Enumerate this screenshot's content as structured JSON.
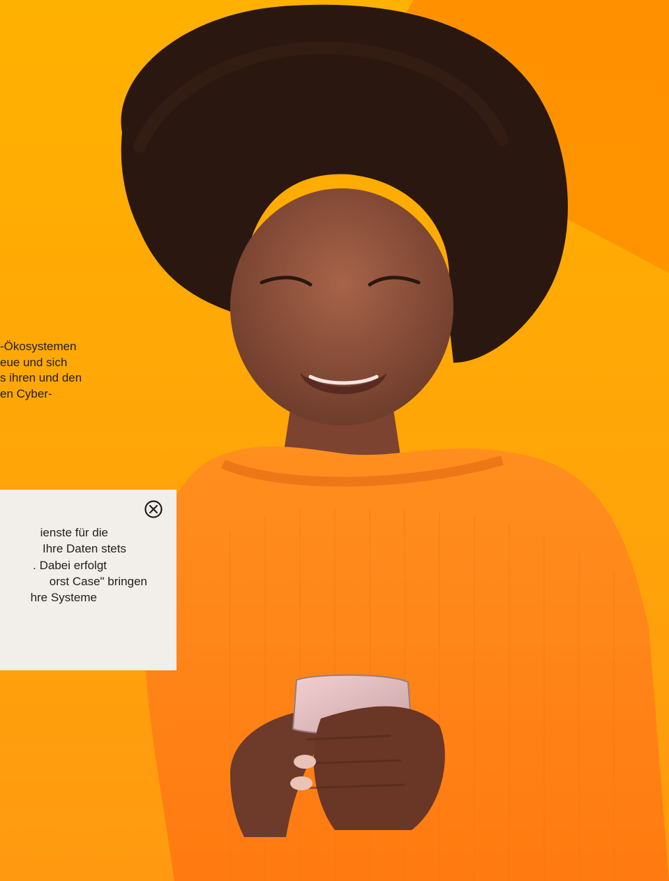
{
  "hero": {
    "text_lines": [
      "-Ökosystemen",
      "eue und sich",
      "s ihren und den",
      "en Cyber-"
    ]
  },
  "popup": {
    "close_icon": "close-circle-icon",
    "lines": [
      "ienste für die",
      "Ihre Daten stets",
      ". Dabei erfolgt",
      "orst Case\" bringen",
      "hre Systeme"
    ]
  },
  "colors": {
    "background_top": "#ffb100",
    "background_bottom": "#ff9a10",
    "accent_corner": "#ff8a00",
    "sweater": "#ff8a1a",
    "popup_bg": "#f2eeea"
  }
}
